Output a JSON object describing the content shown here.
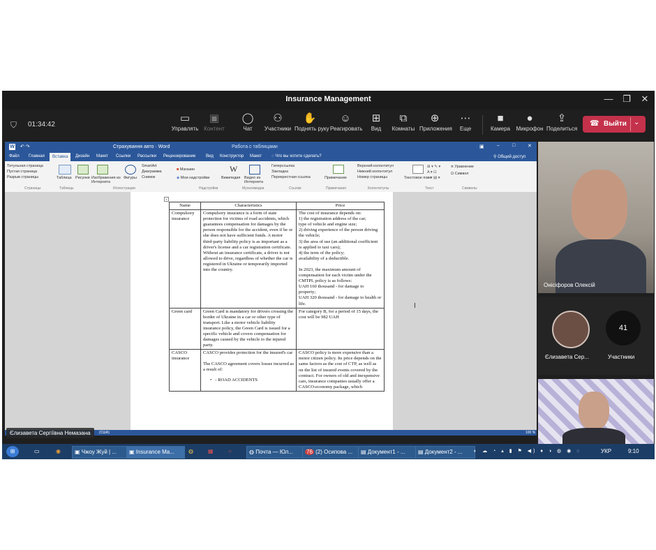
{
  "window": {
    "title": "Insurance Management",
    "controls": [
      "—",
      "❐",
      "✕"
    ]
  },
  "meeting": {
    "timer": "01:34:42",
    "toolbar": [
      {
        "label": "Управлять",
        "icon": "present-icon"
      },
      {
        "label": "Контент",
        "icon": "content-icon"
      },
      {
        "label": "Чат",
        "icon": "chat-icon"
      },
      {
        "label": "Участники",
        "icon": "people-icon"
      },
      {
        "label": "Поднять руку",
        "icon": "hand-icon"
      },
      {
        "label": "Реагировать",
        "icon": "smile-icon"
      },
      {
        "label": "Вид",
        "icon": "grid-icon"
      },
      {
        "label": "Комнаты",
        "icon": "rooms-icon"
      },
      {
        "label": "Приложения",
        "icon": "plus-icon"
      },
      {
        "label": "Еще",
        "icon": "more-icon"
      },
      {
        "label": "Камера",
        "icon": "camera-icon"
      },
      {
        "label": "Микрофон",
        "icon": "mic-icon"
      },
      {
        "label": "Поделиться",
        "icon": "share-icon"
      }
    ],
    "leave_label": "Выйти",
    "leave_color": "#c4314b"
  },
  "word": {
    "title": "Страхування авто · Word",
    "context": "Работа с таблицами",
    "tabs": [
      "Файл",
      "Главная",
      "Вставка",
      "Дизайн",
      "Макет",
      "Ссылки",
      "Рассылки",
      "Рецензирование",
      "Вид",
      "Конструктор",
      "Макет"
    ],
    "tellme": "Что вы хотите сделать?",
    "share": "Общий доступ",
    "ribbon": {
      "pages": [
        "Титульная страница",
        "Пустая страница",
        "Разрыв страницы"
      ],
      "items": [
        "Таблица",
        "Рисунки",
        "Изображения из Интернета",
        "Фигуры",
        "SmartArt",
        "Диаграмма",
        "Снимок",
        "Магазин",
        "Мои надстройки",
        "Википедия",
        "Видео из Интернета",
        "Гиперссылка",
        "Закладка",
        "Перекрестная ссылка",
        "Примечание",
        "Верхний колонтитул",
        "Нижний колонтитул",
        "Номер страницы",
        "Текстовое поле",
        "Уравнение",
        "Символ"
      ],
      "groups": [
        "Страницы",
        "Таблицы",
        "Иллюстрации",
        "Надстройки",
        "Мультимедиа",
        "Ссылки",
        "Примечания",
        "Колонтитулы",
        "Текст",
        "Символы"
      ]
    },
    "table": {
      "headers": [
        "Name",
        "Characteristics",
        "Price"
      ],
      "rows": [
        {
          "name": "Compulsory insurance",
          "chars": [
            "Compulsory insurance is a form of state protection for victims of road accidents, which guarantees compensation for damages by the person responsible for the accident, even if he or she does not have sufficient funds. A motor third-party liability policy is as important as a driver's license and a car registration certificate. Without an insurance certificate, a driver is not allowed to drive, regardless of whether the car is registered in Ukraine or temporarily imported into the country."
          ],
          "price": [
            "The cost of insurance depends on:",
            "1) the registration address of the car;",
            "type of vehicle and engine size;",
            "2) driving experience of the person driving the vehicle;",
            "3) the area of use (an additional coefficient is applied to taxi cars);",
            "4) the term of the policy;",
            "availability of a deductible.",
            "",
            "In 2023, the maximum amount of compensation for each victim under the CMTPL policy is as follows:",
            "UAH 160 thousand - for damage to property;",
            "UAH 320 thousand - for damage to health or life."
          ]
        },
        {
          "name": "Green card",
          "chars": [
            "Green Card is mandatory for drivers crossing the border of Ukraine in a car or other type of transport. Like a motor vehicle liability insurance policy, the Green Card is issued for a specific vehicle and covers compensation for damages caused by the vehicle to the injured party."
          ],
          "price": [
            "For category B, for a period of 15 days, the cost will be 982 UAH"
          ]
        },
        {
          "name": "CASCO insurance",
          "chars": [
            "CASCO provides protection for the insured's car",
            "",
            "The CASCO agreement covers losses incurred as a result of:"
          ],
          "bullet": "- ROAD ACCIDENTS",
          "price": [
            "CASCO policy is more expensive than a motor citizen policy. Its price depends on the same factors as the cost of CTP, as well as on the list of insured events covered by the contract. For owners of old and inexpensive cars, insurance companies usually offer a CASCO-economy package, which"
          ]
        }
      ]
    },
    "status_left": "(США)",
    "zoom": "100 %"
  },
  "presenter_label": "Єлизавета Сергіївна Немазана",
  "participants": {
    "main": "Онісіфоров Олексій",
    "second": "Єлизавета Сер...",
    "count": "41",
    "count_label": "Участники"
  },
  "taskbar": {
    "apps": [
      "Чжоу Жуй | ...",
      "Insurance Ma...",
      "Почта — Юл...",
      "(2) Осипова ...",
      "Документ1 - ...",
      "Документ2 - ..."
    ],
    "badge": "76",
    "lang": "УКР",
    "time": "9:10"
  }
}
